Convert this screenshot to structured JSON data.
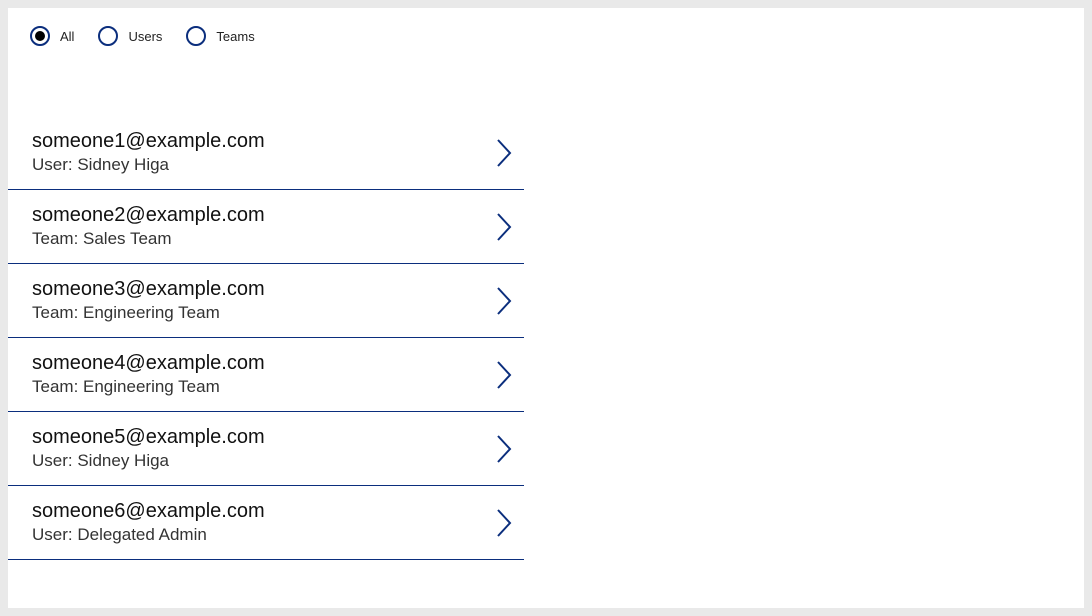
{
  "filters": {
    "options": [
      {
        "key": "all",
        "label": "All",
        "selected": true
      },
      {
        "key": "users",
        "label": "Users",
        "selected": false
      },
      {
        "key": "teams",
        "label": "Teams",
        "selected": false
      }
    ]
  },
  "list": {
    "items": [
      {
        "email": "someone1@example.com",
        "subtitle": "User: Sidney Higa"
      },
      {
        "email": "someone2@example.com",
        "subtitle": "Team: Sales Team"
      },
      {
        "email": "someone3@example.com",
        "subtitle": "Team: Engineering Team"
      },
      {
        "email": "someone4@example.com",
        "subtitle": "Team: Engineering Team"
      },
      {
        "email": "someone5@example.com",
        "subtitle": "User: Sidney Higa"
      },
      {
        "email": "someone6@example.com",
        "subtitle": "User: Delegated Admin"
      }
    ]
  },
  "colors": {
    "accent": "#0b2e7d"
  }
}
